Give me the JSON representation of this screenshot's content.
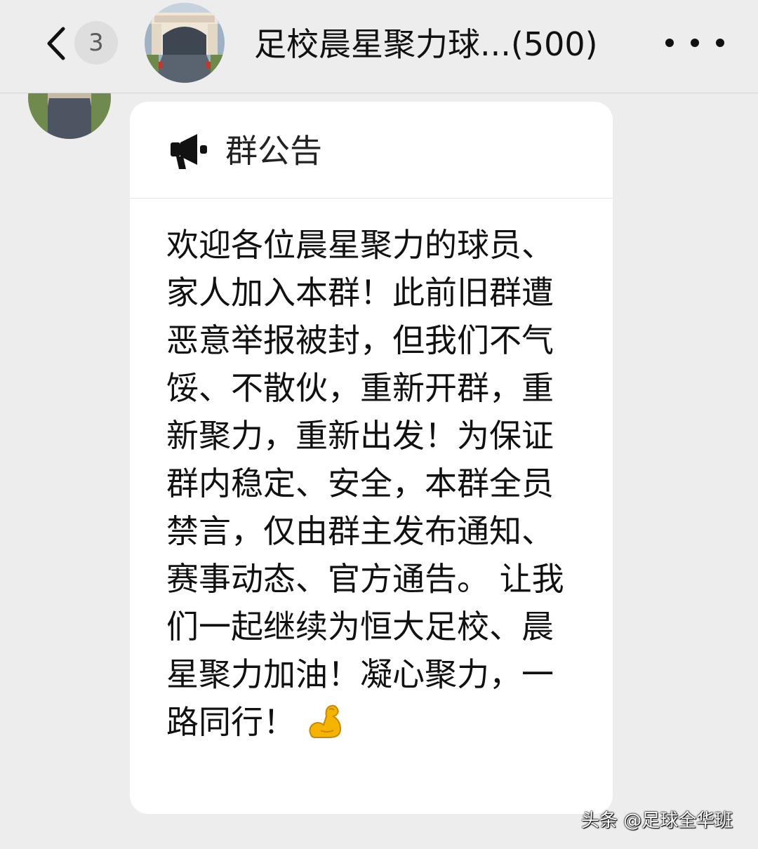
{
  "header": {
    "unread_count": "3",
    "group_title": "足校晨星聚力球...(500)"
  },
  "announcement": {
    "title": "群公告",
    "body": "欢迎各位晨星聚力的球员、家人加入本群！此前旧群遭恶意举报被封，但我们不气馁、不散伙，重新开群，重新聚力，重新出发！为保证群内稳定、安全，本群全员禁言，仅由群主发布通知、赛事动态、官方通告。 让我们一起继续为恒大足校、晨星聚力加油！凝心聚力，一路同行！",
    "emoji": "flexed-biceps"
  },
  "watermark": "头条 @足球全华班",
  "colors": {
    "background": "#ededed",
    "card": "#ffffff",
    "text": "#111111",
    "badge": "#dedede",
    "emoji": "#f4b400"
  }
}
